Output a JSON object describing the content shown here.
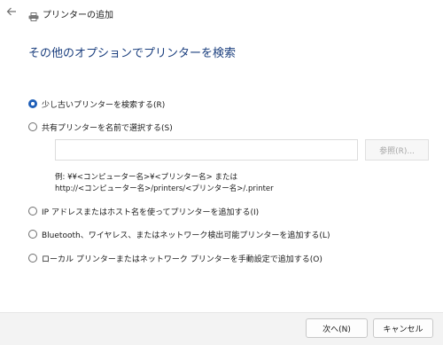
{
  "window": {
    "back_icon": "arrow-left-icon",
    "app_icon": "printer-icon",
    "title": "プリンターの追加"
  },
  "heading": "その他のオプションでプリンターを検索",
  "options": [
    {
      "label": "少し古いプリンターを検索する(R)",
      "selected": true
    },
    {
      "label": "共有プリンターを名前で選択する(S)",
      "selected": false
    },
    {
      "label": "IP アドレスまたはホスト名を使ってプリンターを追加する(I)",
      "selected": false
    },
    {
      "label": "Bluetooth、ワイヤレス、またはネットワーク検出可能プリンターを追加する(L)",
      "selected": false
    },
    {
      "label": "ローカル プリンターまたはネットワーク プリンターを手動設定で追加する(O)",
      "selected": false
    }
  ],
  "share_name": {
    "value": "",
    "browse_label": "参照(R)...",
    "example_line1": "例: ¥¥<コンピューター名>¥<プリンター名> または",
    "example_line2": "http://<コンピューター名>/printers/<プリンター名>/.printer"
  },
  "buttons": {
    "next": "次へ(N)",
    "cancel": "キャンセル"
  }
}
